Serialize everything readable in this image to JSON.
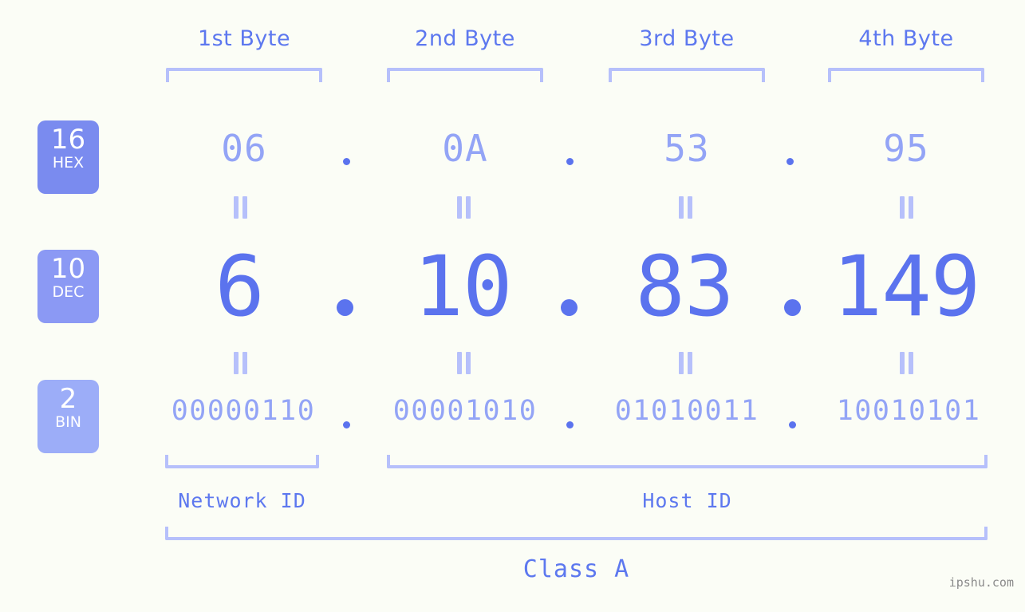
{
  "theme": {
    "background": "#fbfdf6",
    "accent_strong": "#5b73ee",
    "accent_mid": "#93a4f6",
    "accent_light": "#b6c0fb",
    "badge_hex": "#7a8bef",
    "badge_dec": "#8b99f4",
    "badge_bin": "#9cadf8",
    "watermark_color": "#8a8a8a"
  },
  "header": {
    "byte_labels": [
      "1st Byte",
      "2nd Byte",
      "3rd Byte",
      "4th Byte"
    ]
  },
  "bases": [
    {
      "id": "hex",
      "number": "16",
      "label": "HEX"
    },
    {
      "id": "dec",
      "number": "10",
      "label": "DEC"
    },
    {
      "id": "bin",
      "number": "2",
      "label": "BIN"
    }
  ],
  "rows": {
    "hex": {
      "values": [
        "06",
        "0A",
        "53",
        "95"
      ],
      "separator": "."
    },
    "dec": {
      "values": [
        "6",
        "10",
        "83",
        "149"
      ],
      "separator": "."
    },
    "bin": {
      "values": [
        "00000110",
        "00001010",
        "01010011",
        "10010101"
      ],
      "separator": "."
    }
  },
  "equals_symbol": "=",
  "footer": {
    "network_id_label": "Network ID",
    "host_id_label": "Host ID",
    "class_label": "Class A"
  },
  "watermark": "ipshu.com",
  "address": {
    "dotted_decimal": "6.10.83.149",
    "hex": "06.0A.53.95",
    "binary": "00000110.00001010.01010011.10010101",
    "class": "Class A",
    "network_bytes": 1,
    "host_bytes": 3
  }
}
